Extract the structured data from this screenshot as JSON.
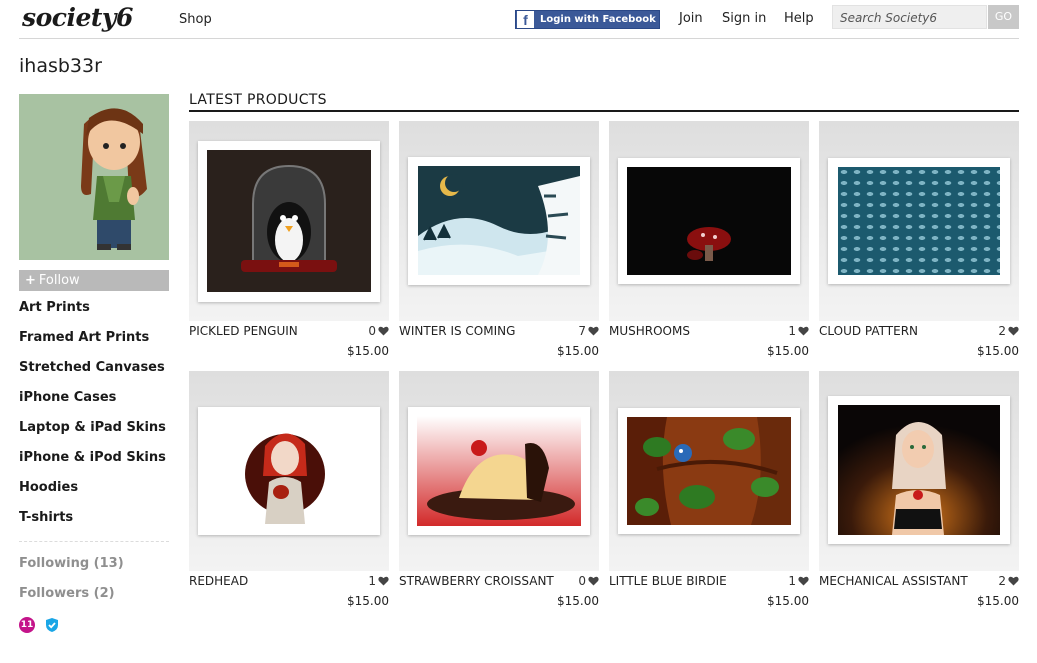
{
  "header": {
    "logo": "society6",
    "nav_shop": "Shop",
    "facebook_login": "Login with Facebook",
    "join": "Join",
    "sign_in": "Sign in",
    "help": "Help",
    "search_placeholder": "Search Society6",
    "search_button": "GO"
  },
  "sidebar": {
    "username": "ihasb33r",
    "follow_label": "Follow",
    "menu": [
      "Art Prints",
      "Framed Art Prints",
      "Stretched Canvases",
      "iPhone Cases",
      "Laptop & iPad Skins",
      "iPhone & iPod Skins",
      "Hoodies",
      "T-shirts"
    ],
    "following": "Following (13)",
    "followers": "Followers (2)",
    "badge_count": "11"
  },
  "main": {
    "section_title": "LATEST PRODUCTS",
    "products": [
      {
        "name": "PICKLED PENGUIN",
        "likes": "0",
        "price": "$15.00"
      },
      {
        "name": "WINTER IS COMING",
        "likes": "7",
        "price": "$15.00"
      },
      {
        "name": "MUSHROOMS",
        "likes": "1",
        "price": "$15.00"
      },
      {
        "name": "CLOUD PATTERN",
        "likes": "2",
        "price": "$15.00"
      },
      {
        "name": "REDHEAD",
        "likes": "1",
        "price": "$15.00"
      },
      {
        "name": "STRAWBERRY CROISSANT",
        "likes": "0",
        "price": "$15.00"
      },
      {
        "name": "LITTLE BLUE BIRDIE",
        "likes": "1",
        "price": "$15.00"
      },
      {
        "name": "MECHANICAL ASSISTANT",
        "likes": "2",
        "price": "$15.00"
      }
    ]
  },
  "colors": {
    "facebook_blue": "#3b5998",
    "badge_pink": "#c4148a",
    "shield_blue": "#1aa6e6",
    "muted_gray": "#8f8f8f"
  }
}
